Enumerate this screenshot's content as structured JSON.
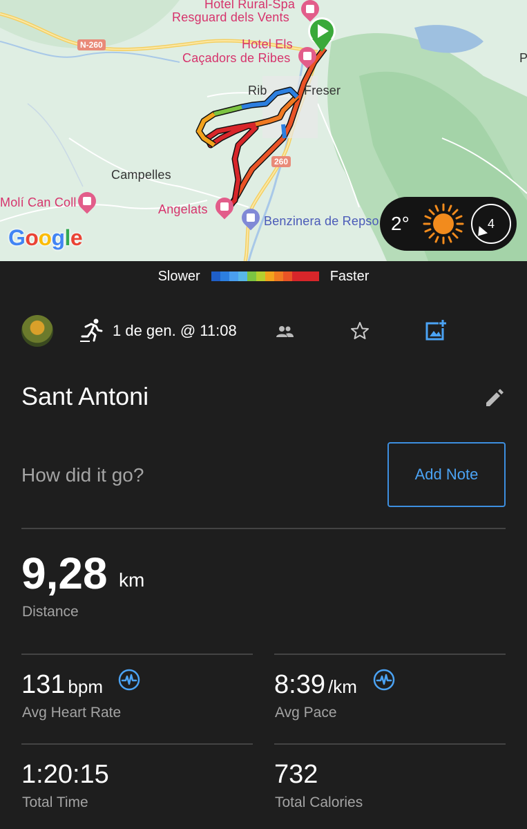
{
  "map": {
    "labels": {
      "hotel_rural_spa_1": "Hotel Rural-Spa",
      "hotel_rural_spa_2": "Resguard dels Vents",
      "hotel_els_1": "Hotel Els",
      "hotel_els_2": "Caçadors de Ribes",
      "ribes": "Ribes de Freser",
      "ribes_left": "Rib",
      "ribes_right": "Freser",
      "campelles": "Campelles",
      "moli": "Molí Can Coll",
      "angelats": "Angelats",
      "benzinera": "Benzinera de Repso",
      "road_n260_top": "N-260",
      "road_n260_mid": "260",
      "edge_p": "P"
    },
    "google_logo": [
      "G",
      "o",
      "o",
      "g",
      "l",
      "e"
    ],
    "weather": {
      "temperature": "2°",
      "icon": "sun-icon",
      "wind_speed": "4"
    }
  },
  "legend": {
    "slower": "Slower",
    "faster": "Faster",
    "colors": [
      "#1f5fc8",
      "#2c7fe0",
      "#4a9ff0",
      "#58b8e8",
      "#7cc442",
      "#b6cf2e",
      "#f2a31d",
      "#f07a22",
      "#ea5426",
      "#d8262a"
    ]
  },
  "header": {
    "activity_icon": "running-icon",
    "date": "1 de gen. @ 11:08",
    "people_icon": "people-icon",
    "star_icon": "star-icon",
    "photo_icon": "add-photo-icon"
  },
  "activity": {
    "title": "Sant Antoni",
    "note_prompt": "How did it go?",
    "add_note": "Add Note"
  },
  "stats": {
    "distance": {
      "value": "9,28",
      "unit": "km",
      "label": "Distance"
    },
    "heart_rate": {
      "value": "131",
      "unit": "bpm",
      "label": "Avg Heart Rate"
    },
    "pace": {
      "value": "8:39",
      "unit": "/km",
      "label": "Avg Pace"
    },
    "time": {
      "value": "1:20:15",
      "label": "Total Time"
    },
    "calories": {
      "value": "732",
      "label": "Total Calories"
    }
  }
}
